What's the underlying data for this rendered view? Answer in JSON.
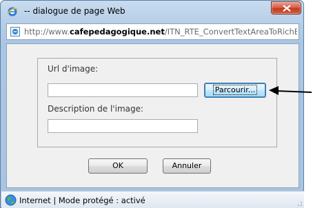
{
  "window": {
    "title": "-- dialogue de page Web",
    "close_label": "X"
  },
  "address": {
    "url_prefix": "http://www.",
    "url_domain": "cafepedagogique.net",
    "url_path": "/ITN_RTE_ConvertTextAreaToRichEd"
  },
  "form": {
    "image_url_label": "Url d'image:",
    "image_url_value": "",
    "browse_label": "Parcourir...",
    "description_label": "Description de l'image:",
    "description_value": ""
  },
  "buttons": {
    "ok_label": "OK",
    "cancel_label": "Annuler"
  },
  "status": {
    "text": "Internet | Mode protégé : activé"
  },
  "colors": {
    "frame": "#aac6e4",
    "close": "#c33b21",
    "content_bg": "#f0f0f0",
    "arrow": "#000000"
  },
  "icons": [
    "ie-icon",
    "page-icon",
    "close-icon",
    "globe-icon",
    "arrow-pointer-icon"
  ]
}
